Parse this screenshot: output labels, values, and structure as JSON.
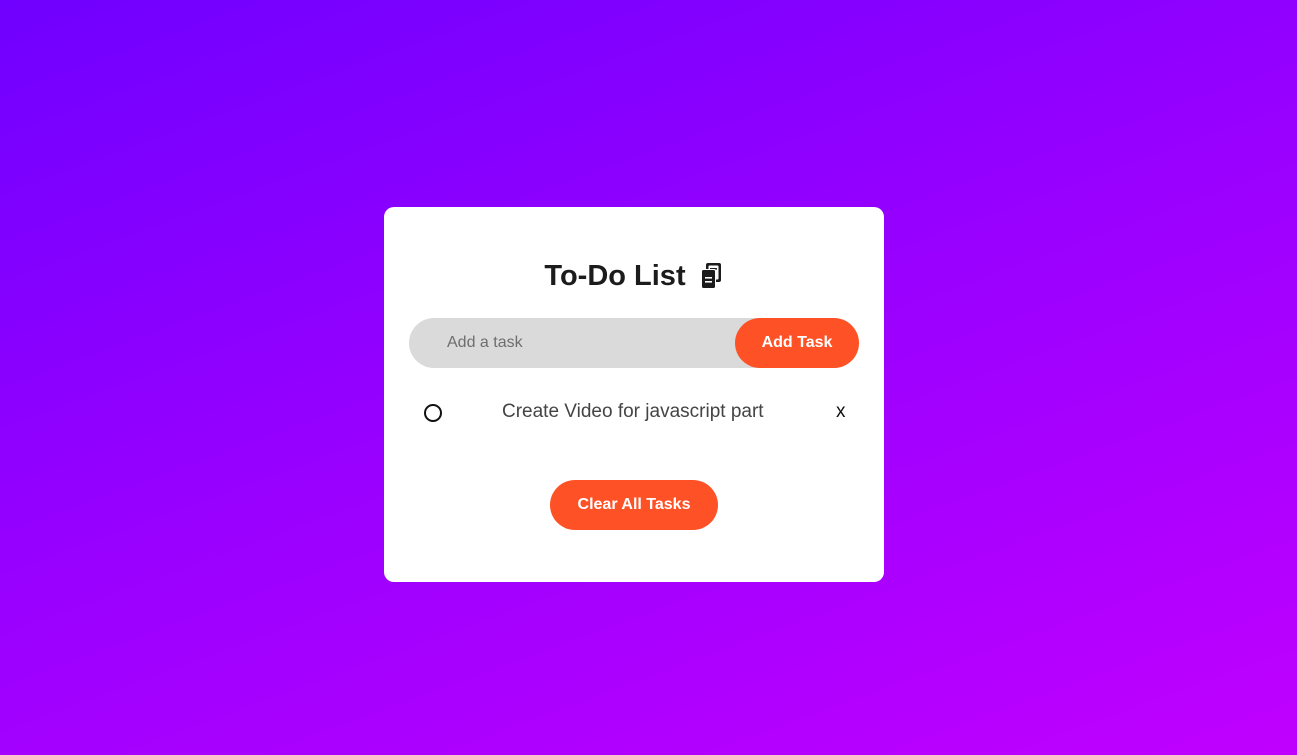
{
  "app": {
    "title": "To-Do List",
    "title_icon": "clipboard-icon"
  },
  "input": {
    "placeholder": "Add a task",
    "value": "",
    "add_label": "Add Task"
  },
  "tasks": [
    {
      "text": "Create Video for javascript part",
      "completed": false,
      "delete_label": "x"
    }
  ],
  "footer": {
    "clear_label": "Clear All Tasks"
  },
  "colors": {
    "accent": "#ff5126",
    "background_start": "#7000ff",
    "background_end": "#c000ff",
    "input_bg": "#dadada"
  }
}
